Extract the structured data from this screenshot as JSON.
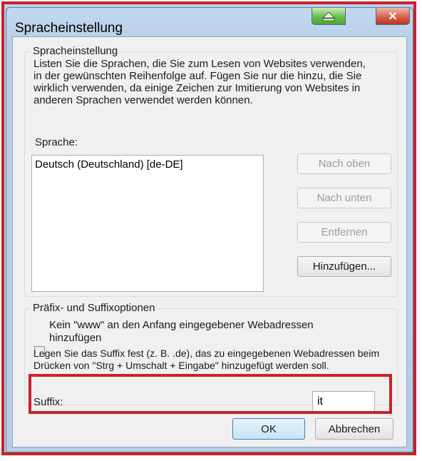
{
  "window": {
    "title": "Spracheinstellung"
  },
  "language_group": {
    "legend": "Spracheinstellung",
    "description": "Listen Sie die Sprachen, die Sie zum Lesen von Websites verwenden, in der gewünschten Reihenfolge auf. Fügen Sie nur die hinzu, die Sie wirklich verwenden, da einige Zeichen zur Imitierung von Websites in anderen Sprachen verwendet werden können.",
    "list_label": "Sprache:",
    "languages": [
      "Deutsch (Deutschland) [de-DE]"
    ],
    "buttons": {
      "up": "Nach oben",
      "down": "Nach unten",
      "remove": "Entfernen",
      "add": "Hinzufügen..."
    }
  },
  "suffix_group": {
    "legend": "Präfix- und Suffixoptionen",
    "checkbox_label_line1": "Kein \"www\" an den Anfang eingegebener Webadressen",
    "checkbox_label_line2": "hinzufügen",
    "description": "Legen Sie das Suffix fest (z. B. .de), das zu eingegebenen Webadressen beim Drücken von \"Strg + Umschalt + Eingabe\" hinzugefügt werden soll.",
    "suffix_label": "Suffix:",
    "suffix_prefix": ".",
    "suffix_value": "it"
  },
  "footer": {
    "ok": "OK",
    "cancel": "Abbrechen"
  },
  "colors": {
    "highlight": "#c8222a"
  }
}
